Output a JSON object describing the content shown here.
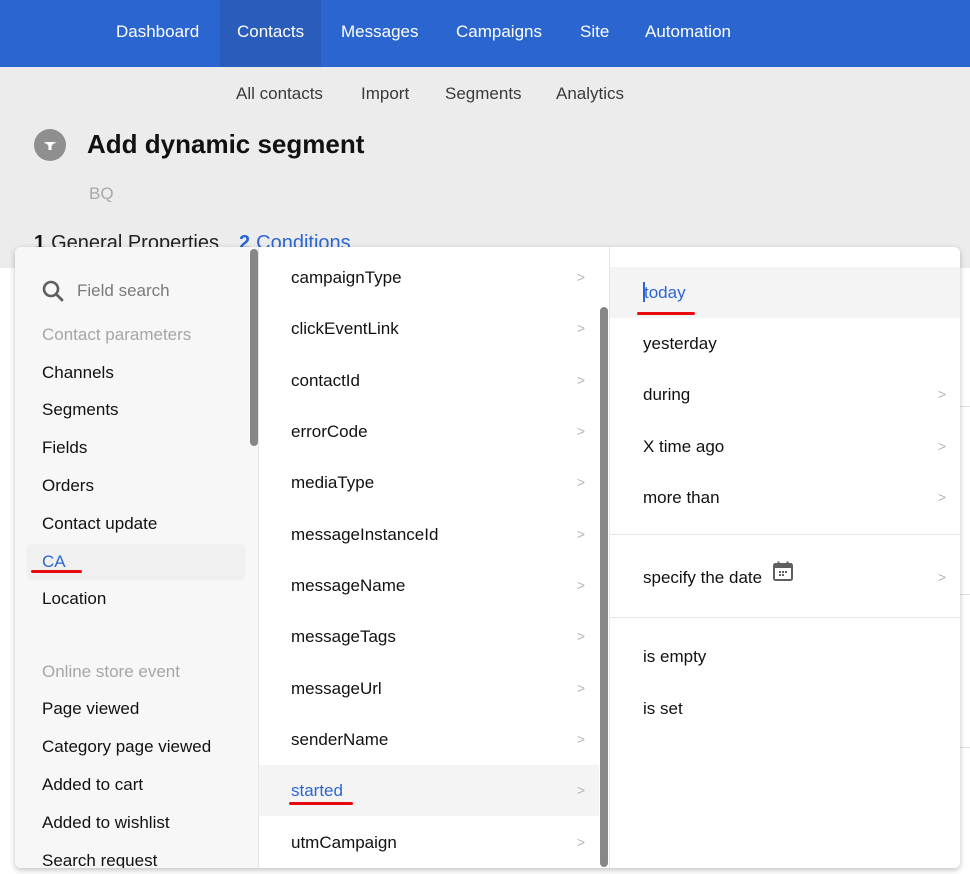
{
  "topnav": {
    "items": [
      {
        "label": "Dashboard"
      },
      {
        "label": "Contacts",
        "active": true
      },
      {
        "label": "Messages"
      },
      {
        "label": "Campaigns"
      },
      {
        "label": "Site"
      },
      {
        "label": "Automation"
      }
    ]
  },
  "subnav": {
    "items": [
      {
        "label": "All contacts"
      },
      {
        "label": "Import"
      },
      {
        "label": "Segments"
      },
      {
        "label": "Analytics"
      }
    ]
  },
  "header": {
    "icon": "filter-icon",
    "title": "Add dynamic segment",
    "subtitle": "BQ"
  },
  "steps": [
    {
      "number": "1",
      "label": "General Properties"
    },
    {
      "number": "2",
      "label": "Conditions"
    }
  ],
  "field_picker": {
    "search": {
      "placeholder": "Field search",
      "icon": "search-icon"
    },
    "groups": [
      {
        "title": "Contact parameters",
        "items": [
          "Channels",
          "Segments",
          "Fields",
          "Orders",
          "Contact update",
          "CA",
          "Location"
        ]
      },
      {
        "title": "Online store event",
        "items": [
          "Page viewed",
          "Category page viewed",
          "Added to cart",
          "Added to wishlist",
          "Search request"
        ]
      }
    ],
    "selected_category": "CA",
    "fields": [
      "campaignType",
      "clickEventLink",
      "contactId",
      "errorCode",
      "mediaType",
      "messageInstanceId",
      "messageName",
      "messageTags",
      "messageUrl",
      "senderName",
      "started",
      "utmCampaign"
    ],
    "selected_field": "started",
    "operators": [
      {
        "label": "today",
        "has_submenu": false,
        "selected": true
      },
      {
        "label": "yesterday",
        "has_submenu": false
      },
      {
        "label": "during",
        "has_submenu": true
      },
      {
        "label": "X time ago",
        "has_submenu": true
      },
      {
        "label": "more than",
        "has_submenu": true
      },
      {
        "label": "specify the date",
        "has_submenu": true,
        "icon": "calendar-icon"
      },
      {
        "label": "is empty",
        "has_submenu": false
      },
      {
        "label": "is set",
        "has_submenu": false
      }
    ],
    "chevron_glyph": ">"
  },
  "colors": {
    "brand": "#2b66d0",
    "highlight": "#e8090f"
  }
}
